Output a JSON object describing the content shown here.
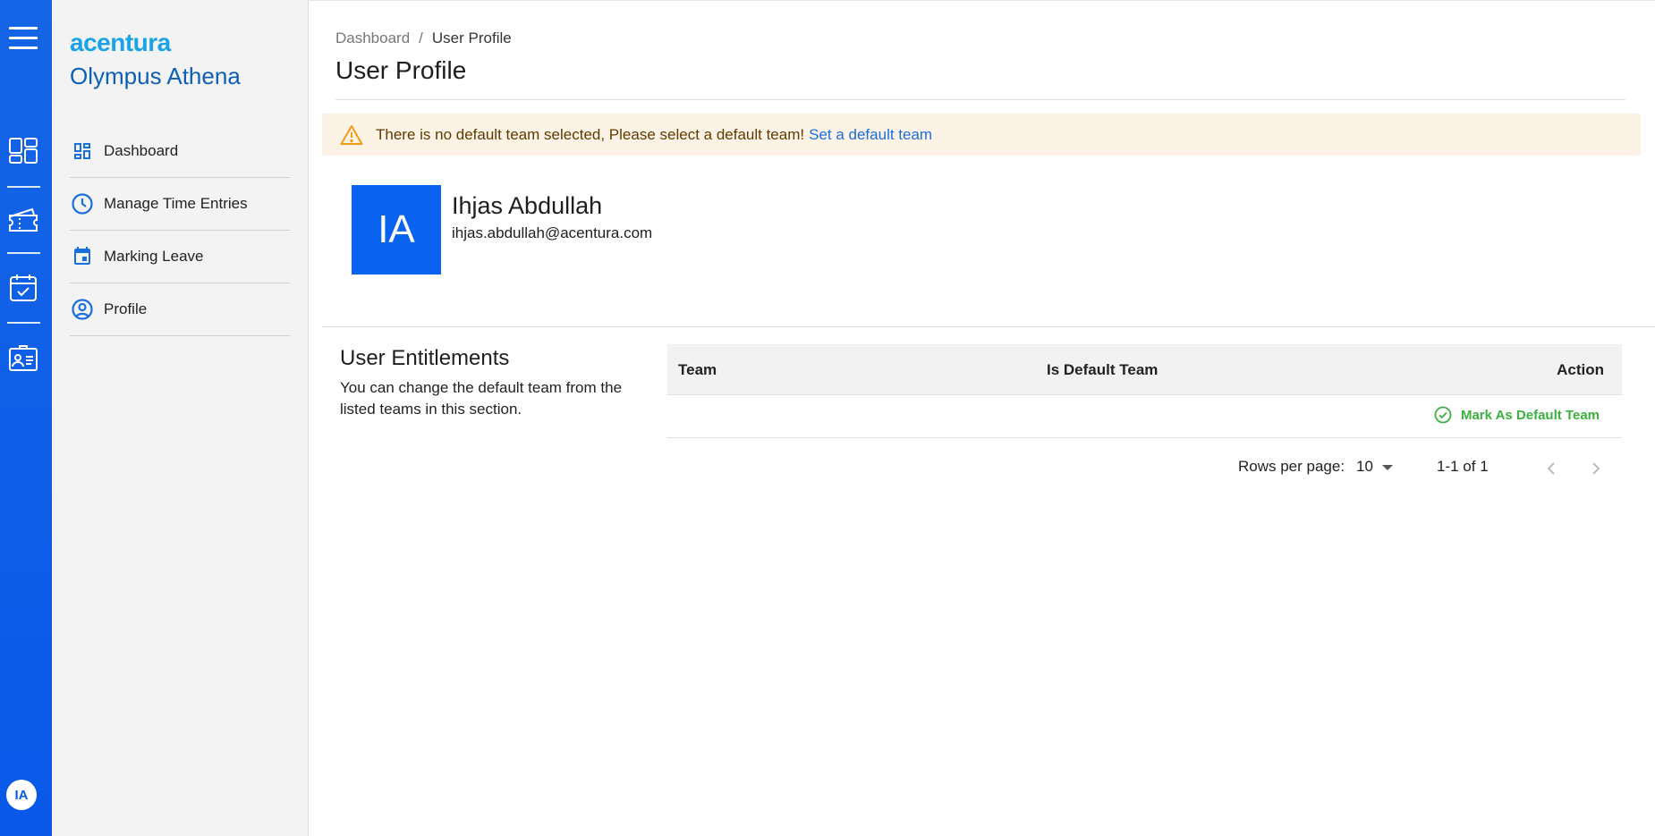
{
  "rail": {
    "avatar_initials": "IA"
  },
  "brand": {
    "logo": "acentura",
    "app_name": "Olympus Athena"
  },
  "nav": {
    "items": [
      {
        "label": "Dashboard",
        "icon": "dashboard-icon"
      },
      {
        "label": "Manage Time Entries",
        "icon": "clock-icon"
      },
      {
        "label": "Marking Leave",
        "icon": "calendar-icon"
      },
      {
        "label": "Profile",
        "icon": "account-circle-icon"
      }
    ]
  },
  "breadcrumb": {
    "parent": "Dashboard",
    "separator": "/",
    "current": "User Profile"
  },
  "page": {
    "title": "User Profile"
  },
  "alert": {
    "message": "There is no default team selected, Please select a default team!",
    "link": "Set a default team"
  },
  "profile": {
    "initials": "IA",
    "name": "Ihjas Abdullah",
    "email": "ihjas.abdullah@acentura.com"
  },
  "entitlements": {
    "title": "User Entitlements",
    "description": "You can change the default team from the listed teams in this section.",
    "columns": [
      "Team",
      "Is Default Team",
      "Action"
    ],
    "rows": [
      {
        "team": "",
        "is_default": "",
        "action": "Mark As Default Team"
      }
    ],
    "pagination": {
      "rows_per_page_label": "Rows per page:",
      "rows_per_page": "10",
      "range": "1-1 of 1"
    }
  },
  "colors": {
    "rail": "#0a58e8",
    "accent": "#1a6fe0",
    "success": "#3db13f",
    "alert_bg": "#fdf2e6"
  }
}
